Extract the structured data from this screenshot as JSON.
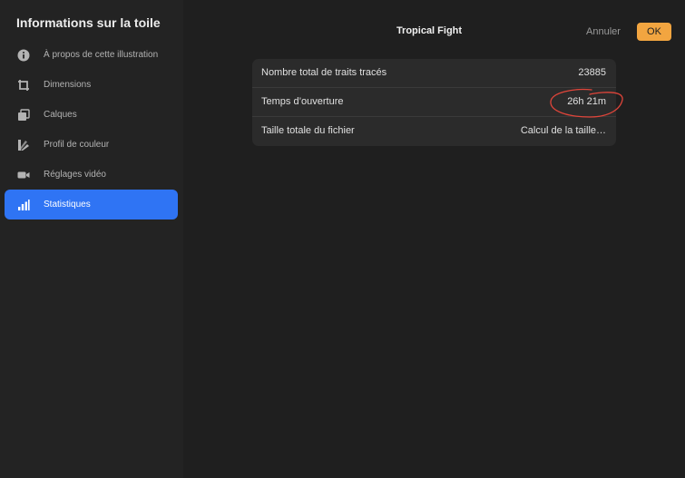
{
  "sidebar": {
    "title": "Informations sur la toile",
    "items": [
      {
        "label": "À propos de cette illustration",
        "icon": "info-icon"
      },
      {
        "label": "Dimensions",
        "icon": "crop-icon"
      },
      {
        "label": "Calques",
        "icon": "layers-icon"
      },
      {
        "label": "Profil de couleur",
        "icon": "color-profile-icon"
      },
      {
        "label": "Réglages vidéo",
        "icon": "video-camera-icon"
      },
      {
        "label": "Statistiques",
        "icon": "bar-chart-icon",
        "active": true
      }
    ]
  },
  "header": {
    "title": "Tropical Fight",
    "cancel_label": "Annuler",
    "ok_label": "OK"
  },
  "stats": {
    "rows": [
      {
        "label": "Nombre total de traits tracés",
        "value": "23885"
      },
      {
        "label": "Temps d’ouverture",
        "value": "26h 21m"
      },
      {
        "label": "Taille totale du fichier",
        "value": "Calcul de la taille…"
      }
    ]
  },
  "colors": {
    "accent_blue": "#2f74f4",
    "ok_orange": "#f2a540",
    "annotation_red": "#e0453a"
  }
}
